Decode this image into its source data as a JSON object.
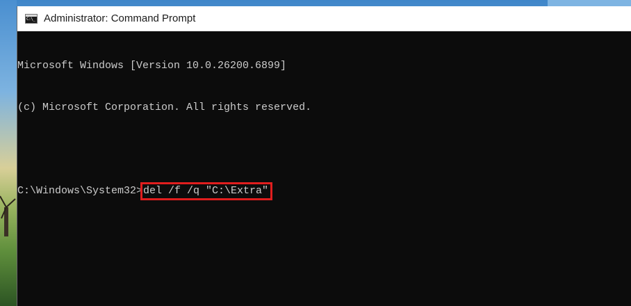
{
  "window": {
    "title": "Administrator: Command Prompt",
    "icon": "cmd-icon",
    "icon_glyph": "C:\\_"
  },
  "console": {
    "lines": [
      "Microsoft Windows [Version 10.0.26200.6899]",
      "(c) Microsoft Corporation. All rights reserved.",
      ""
    ],
    "prompt": "C:\\Windows\\System32>",
    "command": "del /f /q \"C:\\Extra\"",
    "highlight_color": "#e01e1e",
    "text_color": "#cccccc",
    "background_color": "#0c0c0c"
  }
}
